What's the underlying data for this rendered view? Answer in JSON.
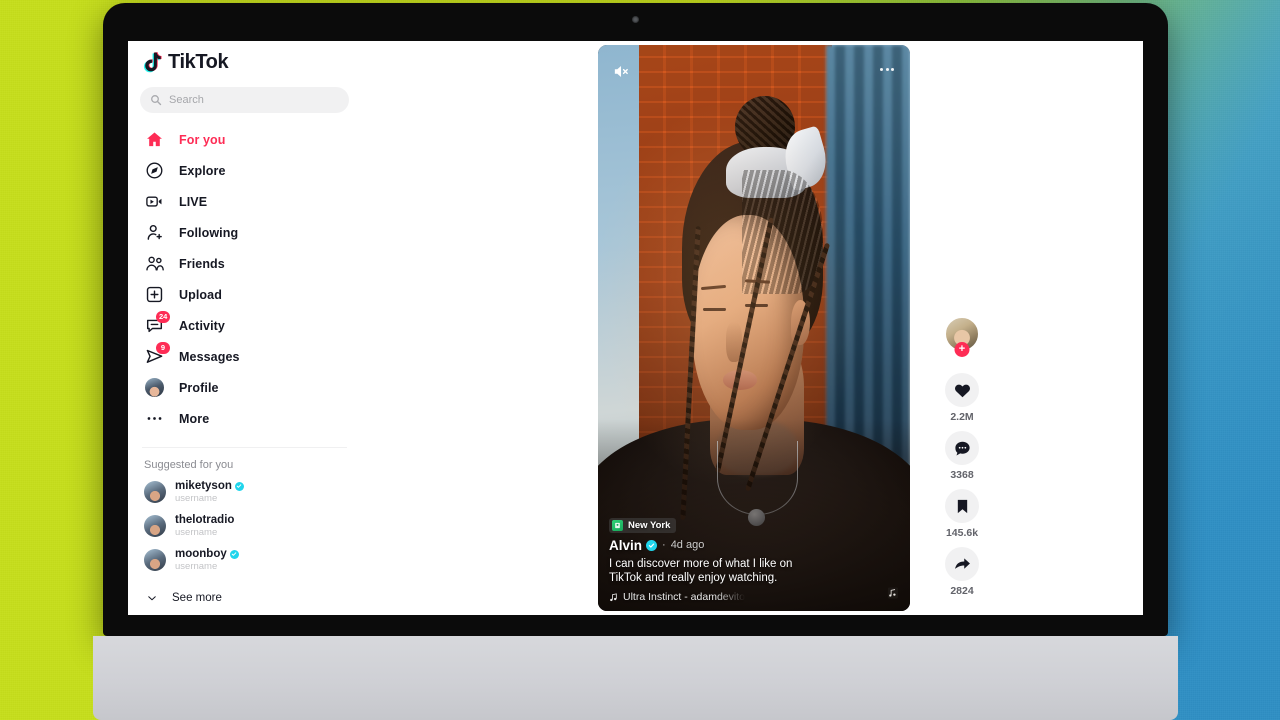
{
  "app": {
    "brand": "TikTok",
    "accent_red": "#fe2c55",
    "accent_cyan": "#20d5ec",
    "text_dark": "#161823"
  },
  "search": {
    "placeholder": "Search",
    "icon": "search-icon"
  },
  "sidebar": {
    "items": [
      {
        "label": "For you",
        "icon": "home-icon",
        "active": true,
        "badge": ""
      },
      {
        "label": "Explore",
        "icon": "compass-icon",
        "active": false,
        "badge": ""
      },
      {
        "label": "LIVE",
        "icon": "live-video-icon",
        "active": false,
        "badge": ""
      },
      {
        "label": "Following",
        "icon": "user-plus-icon",
        "active": false,
        "badge": ""
      },
      {
        "label": "Friends",
        "icon": "users-icon",
        "active": false,
        "badge": ""
      },
      {
        "label": "Upload",
        "icon": "upload-plus-icon",
        "active": false,
        "badge": ""
      },
      {
        "label": "Activity",
        "icon": "activity-inbox-icon",
        "active": false,
        "badge": "24"
      },
      {
        "label": "Messages",
        "icon": "paper-plane-icon",
        "active": false,
        "badge": "9"
      },
      {
        "label": "Profile",
        "icon": "avatar-icon",
        "active": false,
        "badge": ""
      },
      {
        "label": "More",
        "icon": "ellipsis-icon",
        "active": false,
        "badge": ""
      }
    ],
    "suggested_title": "Suggested for you",
    "suggested": [
      {
        "name": "miketyson",
        "handle": "username",
        "verified": true
      },
      {
        "name": "thelotradio",
        "handle": "username",
        "verified": false
      },
      {
        "name": "moonboy",
        "handle": "username",
        "verified": true
      }
    ],
    "see_more": "See more"
  },
  "video": {
    "mute_icon": "speaker-muted-icon",
    "more_icon": "ellipsis-horizontal-icon",
    "location": "New York",
    "location_icon": "location-pin-icon",
    "author": "Alvin",
    "author_verified": true,
    "separator": "·",
    "timestamp": "4d ago",
    "caption_line_1": "I can discover more of what I like on",
    "caption_line_2": "TikTok and really enjoy watching.",
    "music_icon": "music-note-icon",
    "music": "Ultra Instinct - adamdevito",
    "disc_icon": "album-disc-icon"
  },
  "rail": {
    "follow_label": "+",
    "follow_icon": "plus-icon",
    "avatar_icon": "creator-avatar",
    "actions": [
      {
        "icon": "heart-icon",
        "count": "2.2M",
        "name": "like"
      },
      {
        "icon": "comment-icon",
        "count": "3368",
        "name": "comment"
      },
      {
        "icon": "bookmark-icon",
        "count": "145.6k",
        "name": "favorite"
      },
      {
        "icon": "share-arrow-icon",
        "count": "2824",
        "name": "share"
      }
    ]
  }
}
